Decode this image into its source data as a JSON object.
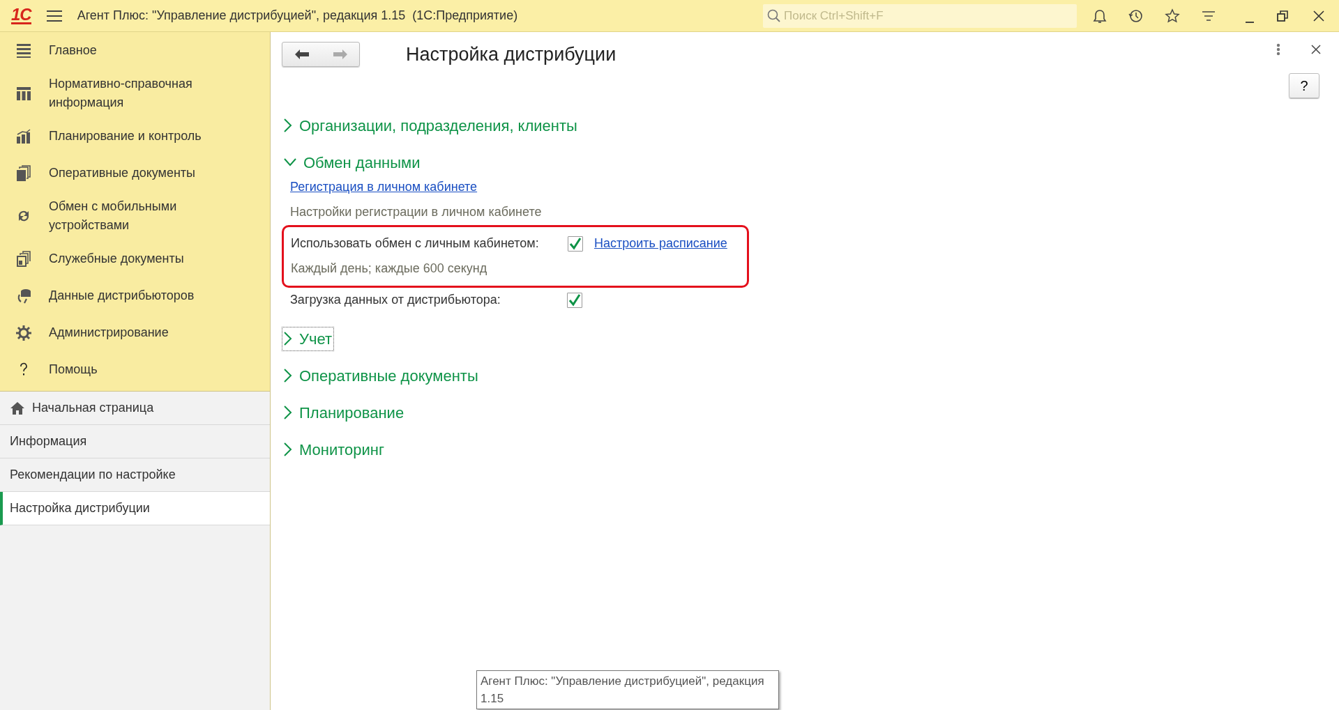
{
  "window": {
    "logo": "1С",
    "title": "Агент Плюс: \"Управление дистрибуцией\", редакция 1.15  (1С:Предприятие)",
    "search": {
      "placeholder": "Поиск Ctrl+Shift+F"
    }
  },
  "sidebar": {
    "sections": [
      {
        "label": "Главное"
      },
      {
        "label": "Нормативно-справочная информация"
      },
      {
        "label": "Планирование и контроль"
      },
      {
        "label": "Оперативные документы"
      },
      {
        "label": "Обмен с мобильными устройствами"
      },
      {
        "label": "Служебные документы"
      },
      {
        "label": "Данные дистрибьюторов"
      },
      {
        "label": "Администрирование"
      },
      {
        "label": "Помощь"
      }
    ],
    "open_windows": [
      {
        "label": "Начальная страница",
        "kind": "home",
        "selected": false
      },
      {
        "label": "Информация",
        "kind": "page",
        "selected": false
      },
      {
        "label": "Рекомендации по настройке",
        "kind": "page",
        "selected": false
      },
      {
        "label": "Настройка дистрибуции",
        "kind": "page",
        "selected": true
      }
    ]
  },
  "form": {
    "title": "Настройка дистрибуции",
    "help_button": "?",
    "sections": [
      {
        "title": "Организации, подразделения, клиенты",
        "expanded": false,
        "focused": false
      },
      {
        "title": "Обмен данными",
        "expanded": true,
        "focused": false,
        "items": [
          {
            "kind": "link",
            "text": "Регистрация в личном кабинете",
            "highlighted": false
          },
          {
            "kind": "note",
            "text": "Настройки регистрации в личном кабинете",
            "highlighted": false
          },
          {
            "kind": "checkbox",
            "label": "Использовать обмен с личным кабинетом:",
            "checked": true,
            "link": "Настроить расписание",
            "highlighted": true
          },
          {
            "kind": "note",
            "text": "Каждый день; каждые 600 секунд",
            "highlighted": true
          },
          {
            "kind": "checkbox",
            "label": "Загрузка данных от дистрибьютора:",
            "checked": true,
            "highlighted": false
          }
        ]
      },
      {
        "title": "Учет",
        "expanded": false,
        "focused": true
      },
      {
        "title": "Оперативные документы",
        "expanded": false,
        "focused": false
      },
      {
        "title": "Планирование",
        "expanded": false,
        "focused": false
      },
      {
        "title": "Мониторинг",
        "expanded": false,
        "focused": false
      }
    ]
  },
  "tooltip": {
    "lines": [
      "Агент Плюс: \"Управление дистрибуцией\", редакция",
      "1.15"
    ]
  }
}
